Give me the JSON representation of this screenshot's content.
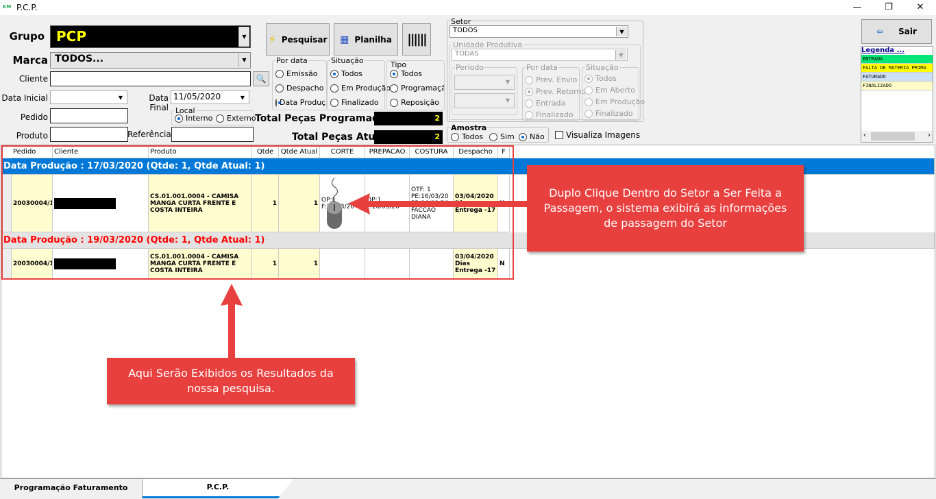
{
  "window": {
    "title": "P.C.P.",
    "logo": "KM",
    "minimize": "—",
    "maximize": "❐",
    "close": "✕"
  },
  "filters": {
    "grupo_label": "Grupo",
    "grupo_value": "PCP",
    "marca_label": "Marca",
    "marca_value": "TODOS...",
    "cliente_label": "Cliente",
    "cliente_value": "",
    "data_inicial_label": "Data Inicial",
    "data_inicial_value": "",
    "data_final_label": "Data Final",
    "data_final_value": "11/05/2020",
    "pedido_label": "Pedido",
    "produto_label": "Produto",
    "referencia_label": "Referência",
    "local": {
      "title": "Local",
      "options": [
        "Interno",
        "Externo"
      ],
      "selected": 0
    }
  },
  "buttons": {
    "pesquisar": "Pesquisar",
    "planilha": "Planilha",
    "sair": "Sair"
  },
  "por_data": {
    "title": "Por data",
    "options": [
      "Emissão",
      "Despacho",
      "Data Produção"
    ],
    "selected": 2
  },
  "situacao": {
    "title": "Situação",
    "options": [
      "Todos",
      "Em Produção",
      "Finalizado"
    ],
    "selected": 0
  },
  "tipo": {
    "title": "Tipo",
    "options": [
      "Todos",
      "Programação",
      "Reposição"
    ],
    "selected": 0
  },
  "totals": {
    "programadas_label": "Total Peças Programadas",
    "programadas_value": "2",
    "atual_label": "Total Peças Atual",
    "atual_value": "2"
  },
  "setor": {
    "title": "Setor",
    "value": "TODOS",
    "unidade": {
      "title": "Unidade Produtiva",
      "value": "TODAS"
    },
    "periodo": {
      "title": "Período"
    },
    "por_data": {
      "title": "Por data",
      "options": [
        "Prev. Envio",
        "Prev. Retorno",
        "Entrada",
        "Finalizado"
      ],
      "selected": 1
    },
    "situacao": {
      "title": "Situação",
      "options": [
        "Todos",
        "Em Aberto",
        "Em Produção",
        "Finalizado"
      ],
      "selected": 0
    }
  },
  "amostra": {
    "title": "Amostra",
    "options": [
      "Todos",
      "Sim",
      "Não"
    ],
    "selected": 2
  },
  "visualiza_imagens": "Visualiza Imagens",
  "legend": {
    "title": "Legenda ...",
    "items": [
      {
        "label": "ENTRADA",
        "color": "#00e676"
      },
      {
        "label": "FALTA DE MATERIA PRIMA",
        "color": "#ffff00"
      },
      {
        "label": "FATURADO",
        "color": "#cce0f5"
      },
      {
        "label": "FINALIZADO",
        "color": "#fffcc8"
      }
    ]
  },
  "grid": {
    "columns": [
      "Pedido",
      "Cliente",
      "Produto",
      "Qtde",
      "Qtde Atual",
      "CORTE",
      "PREPACAO",
      "COSTURA",
      "Despacho",
      "F"
    ],
    "groups": [
      {
        "title": "Data Produção : 17/03/2020 (Qtde: 1, Qtde Atual: 1)",
        "color": "#0078d7",
        "row": {
          "pedido": "20030004/1",
          "produto": "CS.01.001.0004 - CAMISA MANGA CURTA FRENTE E COSTA INTEIRA",
          "qtde": "1",
          "qtde_atual": "1",
          "corte": "OP:1 F:16/03/20",
          "prepacao": "OP:1 F:16/03/20",
          "costura": "OTF: 1 PE:16/03/20 PR:16/03/20 FACCAO DIANA",
          "despacho": "03/04/2020 Dias Entrega -17",
          "f": "N"
        }
      },
      {
        "title": "Data Produção : 19/03/2020 (Qtde: 1, Qtde Atual: 1)",
        "color": "#ff0000",
        "row": {
          "pedido": "20030004/1",
          "produto": "CS.01.001.0004 - CAMISA MANGA CURTA FRENTE E COSTA INTEIRA",
          "qtde": "1",
          "qtde_atual": "1",
          "corte": "",
          "prepacao": "",
          "costura": "",
          "despacho": "03/04/2020 Dias Entrega -17",
          "f": "N"
        }
      }
    ]
  },
  "callouts": {
    "setor": "Duplo Clique Dentro do Setor a Ser Feita a Passagem, o sistema exibirá as informações de passagem do Setor",
    "resultados": "Aqui Serão Exibidos os Resultados da nossa pesquisa."
  },
  "tabs": [
    "Programação Faturamento",
    "P.C.P."
  ]
}
